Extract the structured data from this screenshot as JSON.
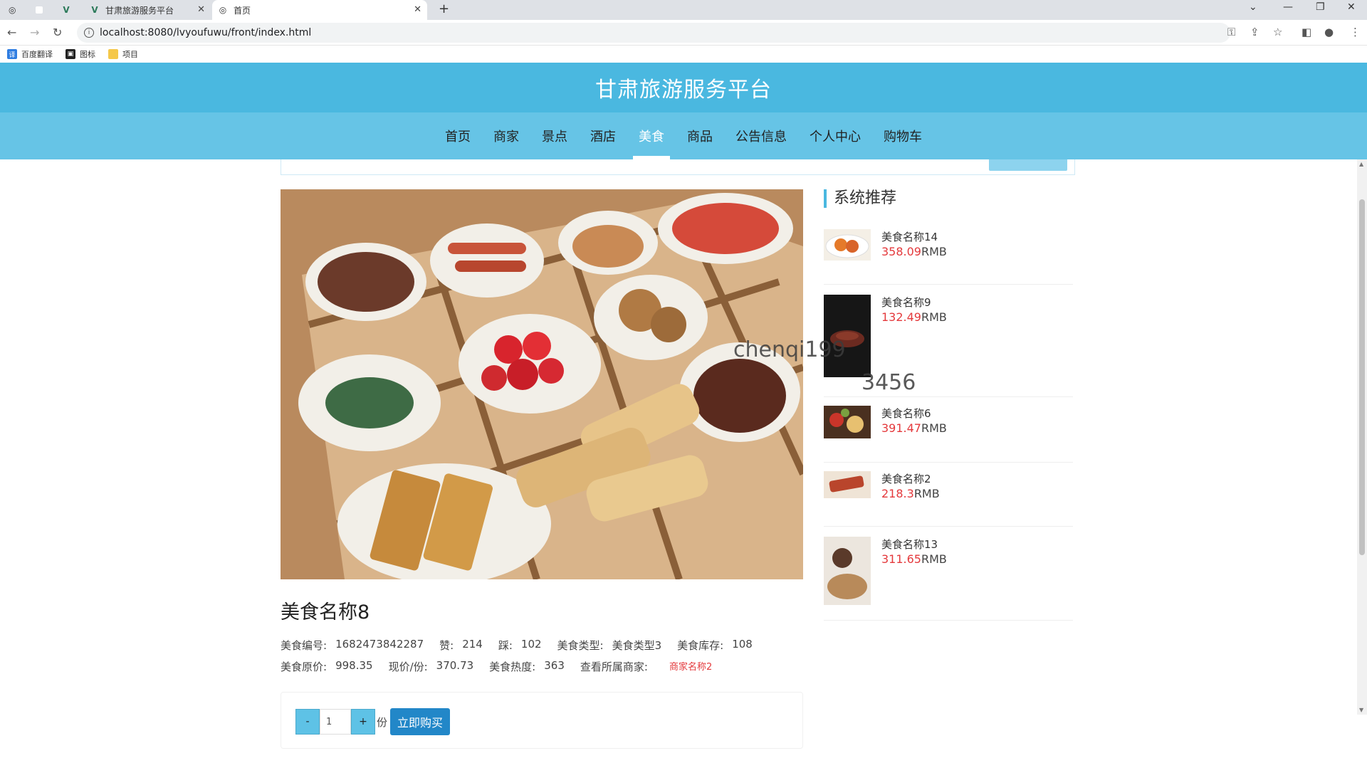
{
  "browser": {
    "tabs": [
      {
        "label": ""
      },
      {
        "label": ""
      },
      {
        "label": ""
      },
      {
        "label": "甘肃旅游服务平台"
      },
      {
        "label": "首页"
      }
    ],
    "url": "localhost:8080/lvyoufuwu/front/index.html",
    "bookmarks": [
      "百度翻译",
      "图标",
      "项目"
    ]
  },
  "site": {
    "title": "甘肃旅游服务平台",
    "nav": [
      "首页",
      "商家",
      "景点",
      "酒店",
      "美食",
      "商品",
      "公告信息",
      "个人中心",
      "购物车"
    ],
    "active_nav": "美食"
  },
  "detail": {
    "title": "美食名称8",
    "row1": {
      "code_label": "美食编号:",
      "code": "1682473842287",
      "like_label": "赞:",
      "like": "214",
      "dislike_label": "踩:",
      "dislike": "102",
      "type_label": "美食类型:",
      "type": "美食类型3",
      "stock_label": "美食库存:",
      "stock": "108"
    },
    "row2": {
      "orig_label": "美食原价:",
      "orig": "998.35",
      "now_label": "现价/份:",
      "now": "370.73",
      "heat_label": "美食热度:",
      "heat": "363",
      "merchant_label": "查看所属商家:",
      "merchant": "商家名称2"
    },
    "qty": "1",
    "minus": "-",
    "plus": "+",
    "unit": "份",
    "buy_label": "立即购买"
  },
  "sidebar": {
    "title": "系统推荐",
    "items": [
      {
        "name": "美食名称14",
        "price": "358.09",
        "currency": "RMB"
      },
      {
        "name": "美食名称9",
        "price": "132.49",
        "currency": "RMB"
      },
      {
        "name": "美食名称6",
        "price": "391.47",
        "currency": "RMB"
      },
      {
        "name": "美食名称2",
        "price": "218.3",
        "currency": "RMB"
      },
      {
        "name": "美食名称13",
        "price": "311.65",
        "currency": "RMB"
      }
    ]
  },
  "watermark": {
    "line1": "chenqi199",
    "line2": "3456"
  },
  "colors": {
    "header": "#4ab8e0",
    "nav": "#66c4e6",
    "price": "#e4393c",
    "buy": "#2287c8"
  }
}
